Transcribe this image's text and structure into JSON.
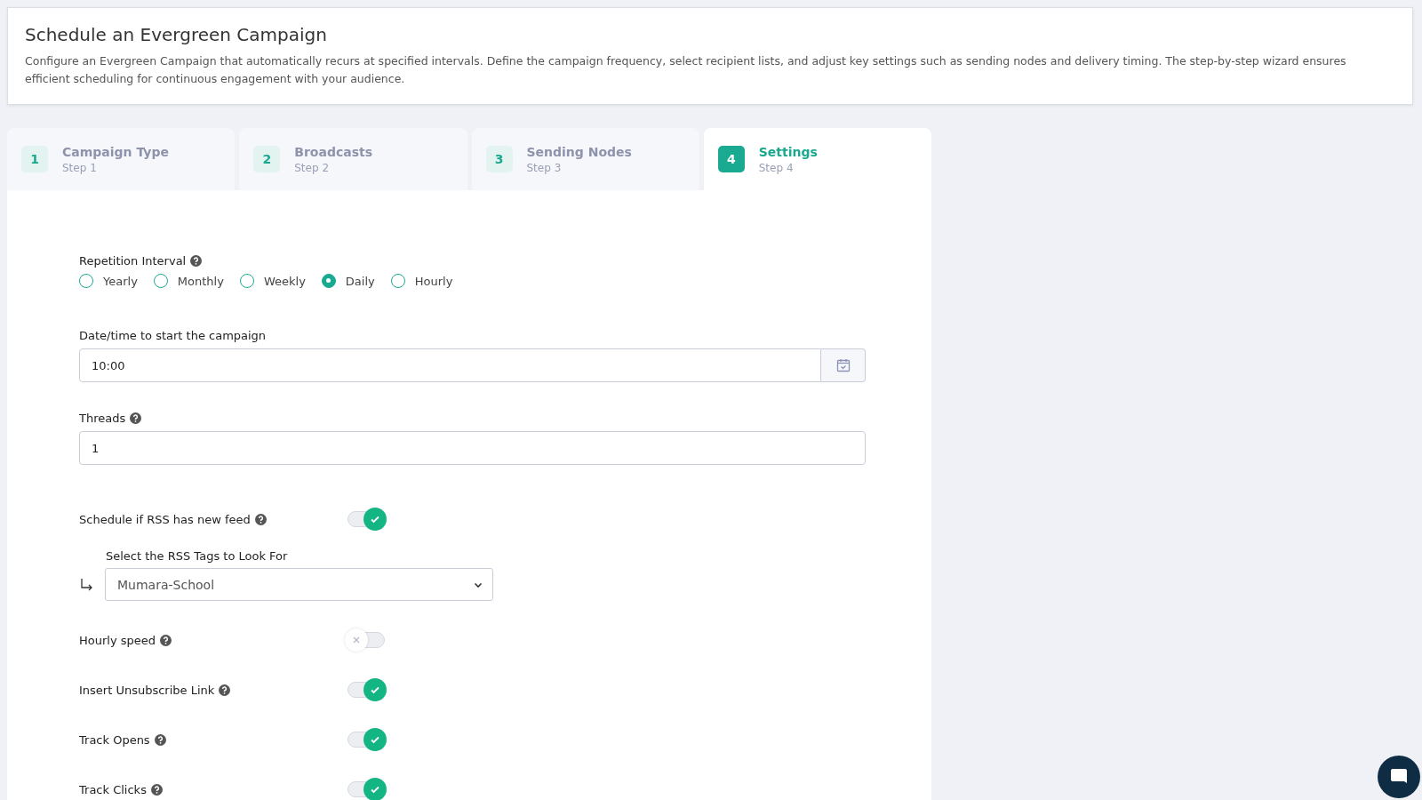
{
  "header": {
    "title": "Schedule an Evergreen Campaign",
    "description": "Configure an Evergreen Campaign that automatically recurs at specified intervals. Define the campaign frequency, select recipient lists, and adjust key settings such as sending nodes and delivery timing. The step-by-step wizard ensures efficient scheduling for continuous engagement with your audience."
  },
  "steps": [
    {
      "number": "1",
      "title": "Campaign Type",
      "subtitle": "Step 1",
      "selected": false
    },
    {
      "number": "2",
      "title": "Broadcasts",
      "subtitle": "Step 2",
      "selected": false
    },
    {
      "number": "3",
      "title": "Sending Nodes",
      "subtitle": "Step 3",
      "selected": false
    },
    {
      "number": "4",
      "title": "Settings",
      "subtitle": "Step 4",
      "selected": true
    }
  ],
  "form": [
    {
      "kind": "radio",
      "label": "Repetition Interval",
      "help": true,
      "options": [
        {
          "label": "Yearly",
          "selected": false
        },
        {
          "label": "Monthly",
          "selected": false
        },
        {
          "label": "Weekly",
          "selected": false
        },
        {
          "label": "Daily",
          "selected": true
        },
        {
          "label": "Hourly",
          "selected": false
        }
      ]
    },
    {
      "kind": "datetime",
      "label": "Date/time to start the campaign",
      "help": false,
      "value": "10:00"
    },
    {
      "kind": "text",
      "label": "Threads",
      "help": true,
      "value": "1"
    },
    {
      "kind": "toggle",
      "label": "Schedule if RSS has new feed",
      "help": true,
      "on": true
    },
    {
      "kind": "select",
      "label": "Select the RSS Tags to Look For",
      "help": false,
      "value": "Mumara-School"
    },
    {
      "kind": "toggle",
      "label": "Hourly speed",
      "help": true,
      "on": false
    },
    {
      "kind": "toggle",
      "label": "Insert Unsubscribe Link",
      "help": true,
      "on": true
    },
    {
      "kind": "toggle",
      "label": "Track Opens",
      "help": true,
      "on": true
    },
    {
      "kind": "toggle",
      "label": "Track Clicks",
      "help": true,
      "on": true
    }
  ]
}
